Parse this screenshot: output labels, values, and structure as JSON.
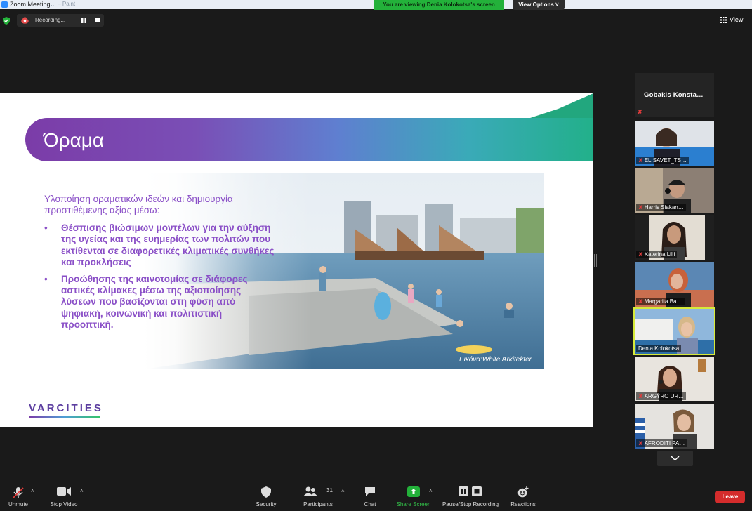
{
  "window": {
    "title": "Zoom Meeting",
    "faded_text": "… – Paint"
  },
  "banner": {
    "viewing": "You are viewing Denia Kolokotsa's screen",
    "view_options": "View Options ˅"
  },
  "recording": {
    "label": "Recording..."
  },
  "top_right": {
    "view_label": "View"
  },
  "slide": {
    "title": "Όραμα",
    "intro": "Υλοποίηση οραματικών ιδεών και δημιουργία προστιθέμενης αξίας μέσω:",
    "bullets": [
      "Θέσπισης βιώσιμων μοντέλων για την αύξηση της υγείας και της ευημερίας των πολιτών που εκτίθενται σε διαφορετικές κλιματικές συνθήκες και προκλήσεις",
      "Προώθησης της καινοτομίας σε διάφορες αστικές κλίμακες μέσω της αξιοποίησης λύσεων που βασίζονται στη φύση από ψηφιακή, κοινωνική και πολιτιστική προοπτική."
    ],
    "bullet_marker": "•",
    "photo_caption": "Εικόνα:White Arkitekter",
    "logo": "VARCITIES",
    "colors": {
      "accent_purple": "#8a4fc7",
      "band_start": "#7b3ca8",
      "band_end": "#22b08a"
    }
  },
  "participants": {
    "name_only_tile": "Gobakis  Konsta…",
    "mic_muted_glyph": "✘",
    "tiles": [
      {
        "name": "ELISAVET_TS…",
        "active": false
      },
      {
        "name": "Harris Siakan…",
        "active": false
      },
      {
        "name": "Katerina Lilli",
        "active": false
      },
      {
        "name": "Margarita Ba…",
        "active": false
      },
      {
        "name": "Denia Kolokotsa",
        "active": true
      },
      {
        "name": "ARGYRO DR…",
        "active": false
      },
      {
        "name": "AFRODITI PA…",
        "active": false
      }
    ]
  },
  "toolbar": {
    "unmute": "Unmute",
    "stop_video": "Stop Video",
    "security": "Security",
    "participants": "Participants",
    "participants_count": "31",
    "chat": "Chat",
    "share_screen": "Share Screen",
    "recording": "Pause/Stop Recording",
    "reactions": "Reactions",
    "leave": "Leave",
    "caret": "˄"
  }
}
